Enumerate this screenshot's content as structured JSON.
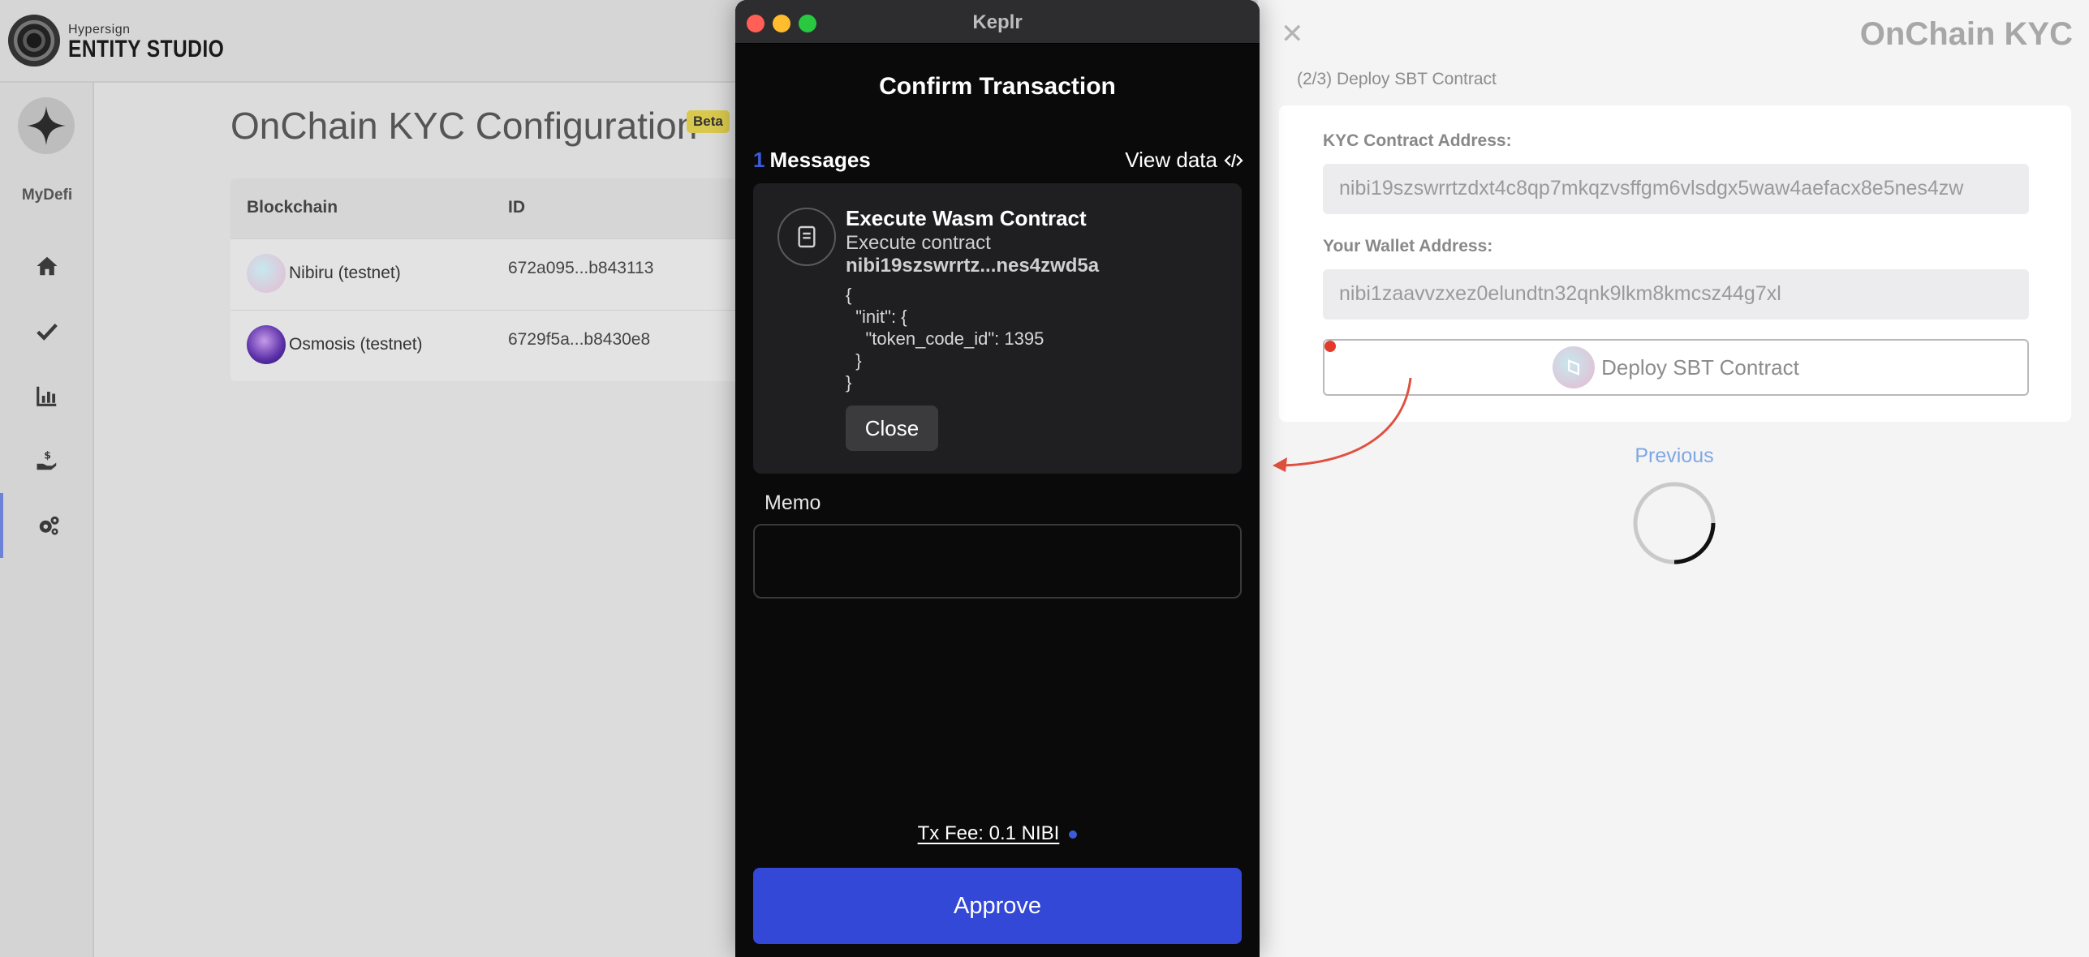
{
  "app": {
    "logo_small": "Hypersign",
    "logo_big": "ENTITY STUDIO",
    "org_name": "MyDefi",
    "page_title": "OnChain KYC Configuration",
    "beta_badge": "Beta",
    "table": {
      "headers": [
        "Blockchain",
        "ID"
      ],
      "rows": [
        {
          "chain": "Nibiru (testnet)",
          "id": "672a095...b843113"
        },
        {
          "chain": "Osmosis (testnet)",
          "id": "6729f5a...b8430e8"
        }
      ]
    },
    "sidebar_icons": [
      "home-icon",
      "check-icon",
      "chart-icon",
      "payment-hand-icon",
      "settings-gears-icon"
    ]
  },
  "keplr": {
    "window_title": "Keplr",
    "header": "Confirm Transaction",
    "message_count": "1",
    "messages_label": "Messages",
    "view_data_label": "View data",
    "message": {
      "title": "Execute Wasm Contract",
      "subtitle": "Execute contract",
      "contract": "nibi19szswrrtz...nes4zwd5a",
      "json": "{\n  \"init\": {\n    \"token_code_id\": 1395\n  }\n}",
      "close_label": "Close"
    },
    "memo_label": "Memo",
    "memo_value": "",
    "fee_text": "Tx Fee: 0.1 NIBI",
    "approve_label": "Approve"
  },
  "panel": {
    "title": "OnChain KYC",
    "step": "(2/3) Deploy SBT Contract",
    "kyc_label": "KYC Contract Address:",
    "kyc_value": "nibi19szswrrtzdxt4c8qp7mkqzvsffgm6vlsdgx5waw4aefacx8e5nes4zw",
    "wallet_label": "Your Wallet Address:",
    "wallet_value": "nibi1zaavvzxez0elundtn32qnk9lkm8kmcsz44g7xl",
    "deploy_label": "Deploy SBT Contract",
    "previous_label": "Previous"
  },
  "colors": {
    "approve": "#3348d6",
    "accent_blue": "#3b5bdb",
    "annotation_red": "#e23a2c",
    "beta": "#d9c84e"
  }
}
